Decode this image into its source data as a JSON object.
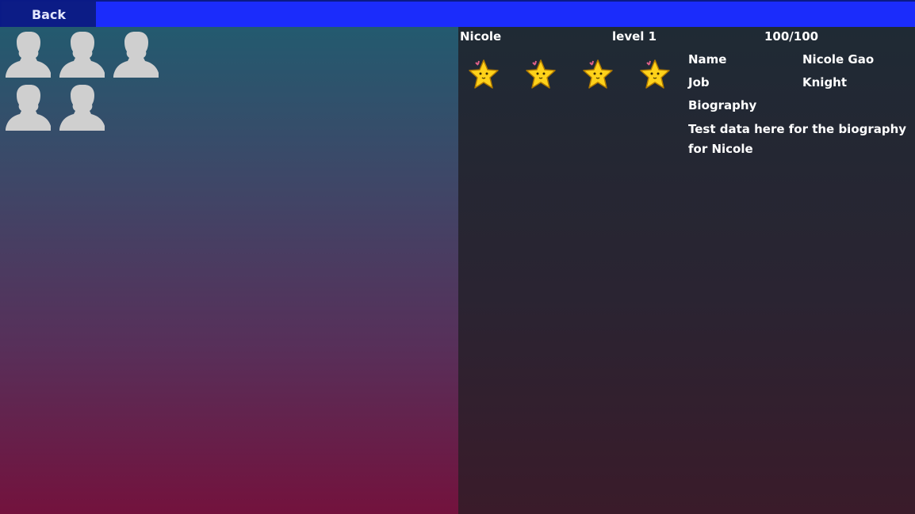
{
  "toolbar": {
    "back_label": "Back"
  },
  "roster": {
    "avatars": [
      {
        "icon": "person-silhouette-icon"
      },
      {
        "icon": "person-silhouette-icon"
      },
      {
        "icon": "person-silhouette-icon"
      },
      {
        "icon": "person-silhouette-icon"
      },
      {
        "icon": "person-silhouette-icon"
      }
    ]
  },
  "character": {
    "short_name": "Nicole",
    "level": "level 1",
    "hp": "100/100",
    "rating_stars": 4,
    "name_label": "Name",
    "name_value": "Nicole Gao",
    "job_label": "Job",
    "job_value": "Knight",
    "biography_label": "Biography",
    "biography_text": "Test data here for the biography for Nicole"
  },
  "colors": {
    "topbar": "#1b2cfb",
    "back_button": "#0c1c86",
    "avatar_gray": "#cfcfcf",
    "star": "#ffd21a"
  }
}
